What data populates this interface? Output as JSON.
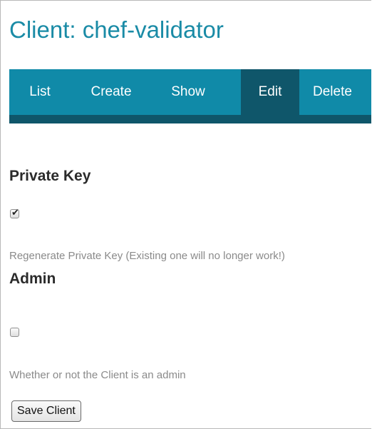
{
  "page": {
    "title": "Client: chef-validator"
  },
  "nav": {
    "tabs": [
      {
        "label": "List"
      },
      {
        "label": "Create"
      },
      {
        "label": "Show"
      },
      {
        "label": "Edit",
        "active": true
      },
      {
        "label": "Delete"
      }
    ]
  },
  "form": {
    "private_key": {
      "heading": "Private Key",
      "checked": true,
      "help": "Regenerate Private Key (Existing one will no longer work!)"
    },
    "admin": {
      "heading": "Admin",
      "checked": false,
      "help": "Whether or not the Client is an admin"
    },
    "save_label": "Save Client"
  },
  "colors": {
    "accent": "#108aa8",
    "tab_active": "#0f566a",
    "title": "#1a8ba6",
    "help_text": "#8a8a8a"
  }
}
